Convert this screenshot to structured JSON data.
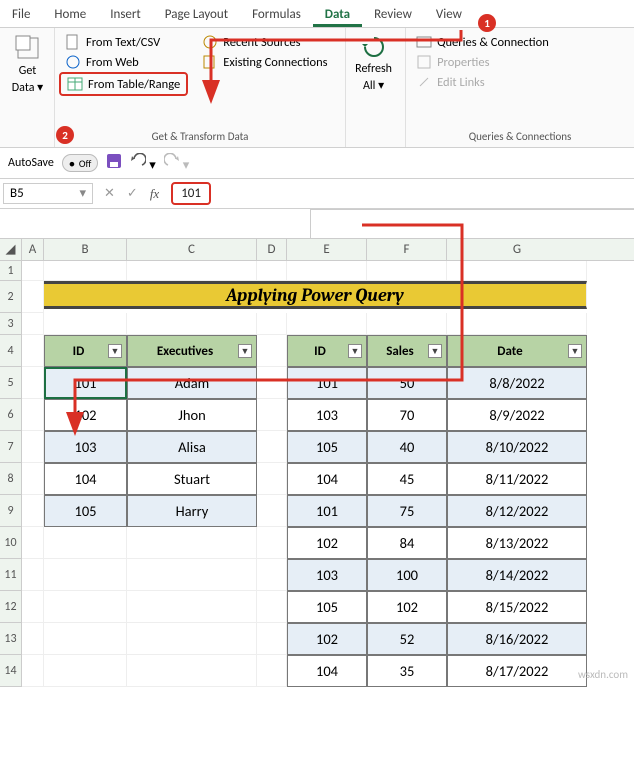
{
  "tabs": [
    "File",
    "Home",
    "Insert",
    "Page Layout",
    "Formulas",
    "Data",
    "Review",
    "View"
  ],
  "active_tab": "Data",
  "callouts": {
    "c1": "1",
    "c2": "2"
  },
  "ribbon": {
    "get_data": {
      "label": "Get",
      "label2": "Data"
    },
    "transform": {
      "from_text": "From Text/CSV",
      "from_web": "From Web",
      "from_table": "From Table/Range",
      "recent": "Recent Sources",
      "existing": "Existing Connections",
      "group_label": "Get & Transform Data"
    },
    "refresh": {
      "label": "Refresh",
      "label2": "All"
    },
    "qconn": {
      "queries": "Queries & Connection",
      "props": "Properties",
      "edit": "Edit Links",
      "group_label": "Queries & Connections"
    }
  },
  "qat": {
    "autosave": "AutoSave",
    "autosave_state": "Off"
  },
  "namebox": "B5",
  "fx_value": "101",
  "columns": [
    "A",
    "B",
    "C",
    "D",
    "E",
    "F",
    "G"
  ],
  "rownums": [
    "1",
    "2",
    "3",
    "4",
    "5",
    "6",
    "7",
    "8",
    "9",
    "10",
    "11",
    "12",
    "13",
    "14"
  ],
  "banner": "Applying Power Query",
  "table1": {
    "headers": [
      "ID",
      "Executives"
    ],
    "rows": [
      [
        "101",
        "Adam"
      ],
      [
        "102",
        "Jhon"
      ],
      [
        "103",
        "Alisa"
      ],
      [
        "104",
        "Stuart"
      ],
      [
        "105",
        "Harry"
      ]
    ]
  },
  "table2": {
    "headers": [
      "ID",
      "Sales",
      "Date"
    ],
    "rows": [
      [
        "101",
        "50",
        "8/8/2022"
      ],
      [
        "103",
        "70",
        "8/9/2022"
      ],
      [
        "105",
        "40",
        "8/10/2022"
      ],
      [
        "104",
        "45",
        "8/11/2022"
      ],
      [
        "101",
        "75",
        "8/12/2022"
      ],
      [
        "102",
        "84",
        "8/13/2022"
      ],
      [
        "103",
        "100",
        "8/14/2022"
      ],
      [
        "105",
        "102",
        "8/15/2022"
      ],
      [
        "102",
        "52",
        "8/16/2022"
      ],
      [
        "104",
        "35",
        "8/17/2022"
      ]
    ]
  },
  "watermark": "wsxdn.com"
}
